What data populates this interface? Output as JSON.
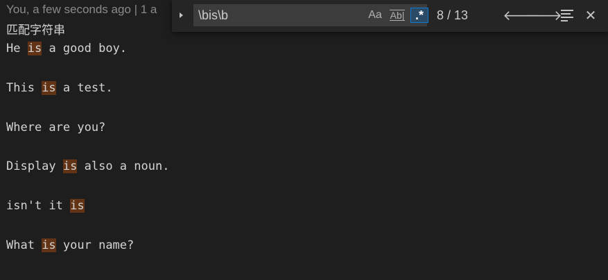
{
  "editor": {
    "codelens": "You, a few seconds ago | 1 a",
    "comment": "匹配字符串",
    "lines": [
      [
        {
          "t": "He "
        },
        {
          "t": "is",
          "hl": true
        },
        {
          "t": " a good boy."
        }
      ],
      [],
      [
        {
          "t": "This "
        },
        {
          "t": "is",
          "hl": true
        },
        {
          "t": " a test."
        }
      ],
      [],
      [
        {
          "t": "Where are you?"
        }
      ],
      [],
      [
        {
          "t": "Display "
        },
        {
          "t": "is",
          "hl": true
        },
        {
          "t": " also a noun."
        }
      ],
      [],
      [
        {
          "t": "isn't it "
        },
        {
          "t": "is",
          "hl": true
        }
      ],
      [],
      [
        {
          "t": "What "
        },
        {
          "t": "is",
          "hl": true
        },
        {
          "t": " your name?"
        }
      ]
    ]
  },
  "find": {
    "query": "\\bis\\b",
    "match_case_label": "Aa",
    "whole_word_label": "Ab|",
    "regex_label": ".*",
    "match_count": "8 / 13",
    "prev_icon": "arrow-up-icon",
    "next_icon": "arrow-down-icon",
    "selection_icon": "find-in-selection-icon",
    "close_icon": "close-icon",
    "prev_glyph": "🡐",
    "next_glyph": "🡒",
    "close_glyph": "✕"
  },
  "colors": {
    "match_highlight": "#623315",
    "regex_active_border": "#0e7ad3"
  }
}
